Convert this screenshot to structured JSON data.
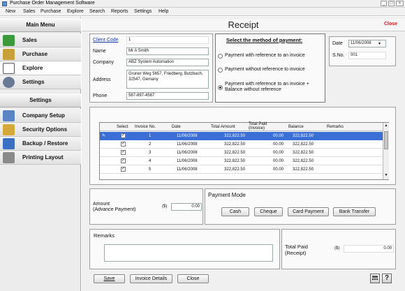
{
  "window": {
    "title": "Purchase Order Management Software"
  },
  "menu": [
    "New",
    "Sales",
    "Purchase",
    "Explore",
    "Search",
    "Reports",
    "Settings",
    "Help"
  ],
  "sidebar": {
    "main_heading": "Main Menu",
    "main_items": [
      {
        "label": "Sales",
        "icon": "sales-icon"
      },
      {
        "label": "Purchase",
        "icon": "purchase-icon"
      },
      {
        "label": "Explore",
        "icon": "explore-icon"
      },
      {
        "label": "Settings",
        "icon": "settings-icon"
      }
    ],
    "settings_heading": "Settings",
    "settings_items": [
      {
        "label": "Company Setup",
        "icon": "company-setup-icon"
      },
      {
        "label": "Security Options",
        "icon": "security-icon"
      },
      {
        "label": "Backup / Restore",
        "icon": "backup-icon"
      },
      {
        "label": "Printing Layout",
        "icon": "printer-icon"
      }
    ]
  },
  "receipt": {
    "title": "Receipt",
    "close_label": "Close",
    "client": {
      "code_label": "Client Code",
      "code": "1",
      "name_label": "Name",
      "name": "Mr A Smith",
      "company_label": "Company",
      "company": "ABZ System Automation",
      "address_label": "Address",
      "address": "Gruner Weg 5657, Friedberg, Butzbach, 32547, Gemany",
      "phone_label": "Phone",
      "phone": "567-897-4567"
    },
    "payment_method": {
      "heading": "Select the method of payment:",
      "options": [
        "Payment with reference to an invoice",
        "Payment without reference to invoice",
        "Payment with reference to an invoice + Balance without reference"
      ],
      "selected_index": 2
    },
    "date_label": "Date",
    "date": "11/06/2008",
    "sno_label": "S.No.",
    "sno": "001",
    "grid": {
      "columns": [
        "Select",
        "Invoice No.",
        "Date",
        "Total Amount",
        "Total Paid (Invoice)",
        "Balance",
        "Remarks"
      ],
      "rows": [
        {
          "invoice": "1",
          "date": "11/06/2008",
          "total": "322,822.50",
          "paid": "00.00",
          "balance": "322,822.50",
          "selected": true
        },
        {
          "invoice": "2",
          "date": "11/06/2008",
          "total": "322,822.50",
          "paid": "00.00",
          "balance": "322,822.50",
          "selected": true
        },
        {
          "invoice": "3",
          "date": "11/06/2008",
          "total": "322,822.50",
          "paid": "00.00",
          "balance": "322,822.50",
          "selected": true
        },
        {
          "invoice": "4",
          "date": "11/06/2008",
          "total": "322,822.50",
          "paid": "00.00",
          "balance": "322,822.50",
          "selected": true
        },
        {
          "invoice": "5",
          "date": "11/06/2008",
          "total": "322,822.50",
          "paid": "00.00",
          "balance": "322,822.50",
          "selected": true
        }
      ]
    },
    "amount": {
      "label": "Amount",
      "sublabel": "(Advance Payment)",
      "currency": "($)",
      "value": "0.00"
    },
    "payment_mode": {
      "heading": "Payment Mode",
      "buttons": [
        "Cash",
        "Cheque",
        "Card Payment",
        "Bank Transfer"
      ]
    },
    "remarks": {
      "label": "Remarks",
      "value": ""
    },
    "total_paid": {
      "label": "Total Paid",
      "sublabel": "(Receipt)",
      "currency": "($)",
      "value": "0.00"
    },
    "actions": {
      "save": "Save",
      "invoice_details": "Invoice Details",
      "close": "Close"
    }
  },
  "colors": {
    "accent_red": "#d21919",
    "selected_row": "#3b6fd6",
    "link_blue": "#1a3a9e"
  }
}
